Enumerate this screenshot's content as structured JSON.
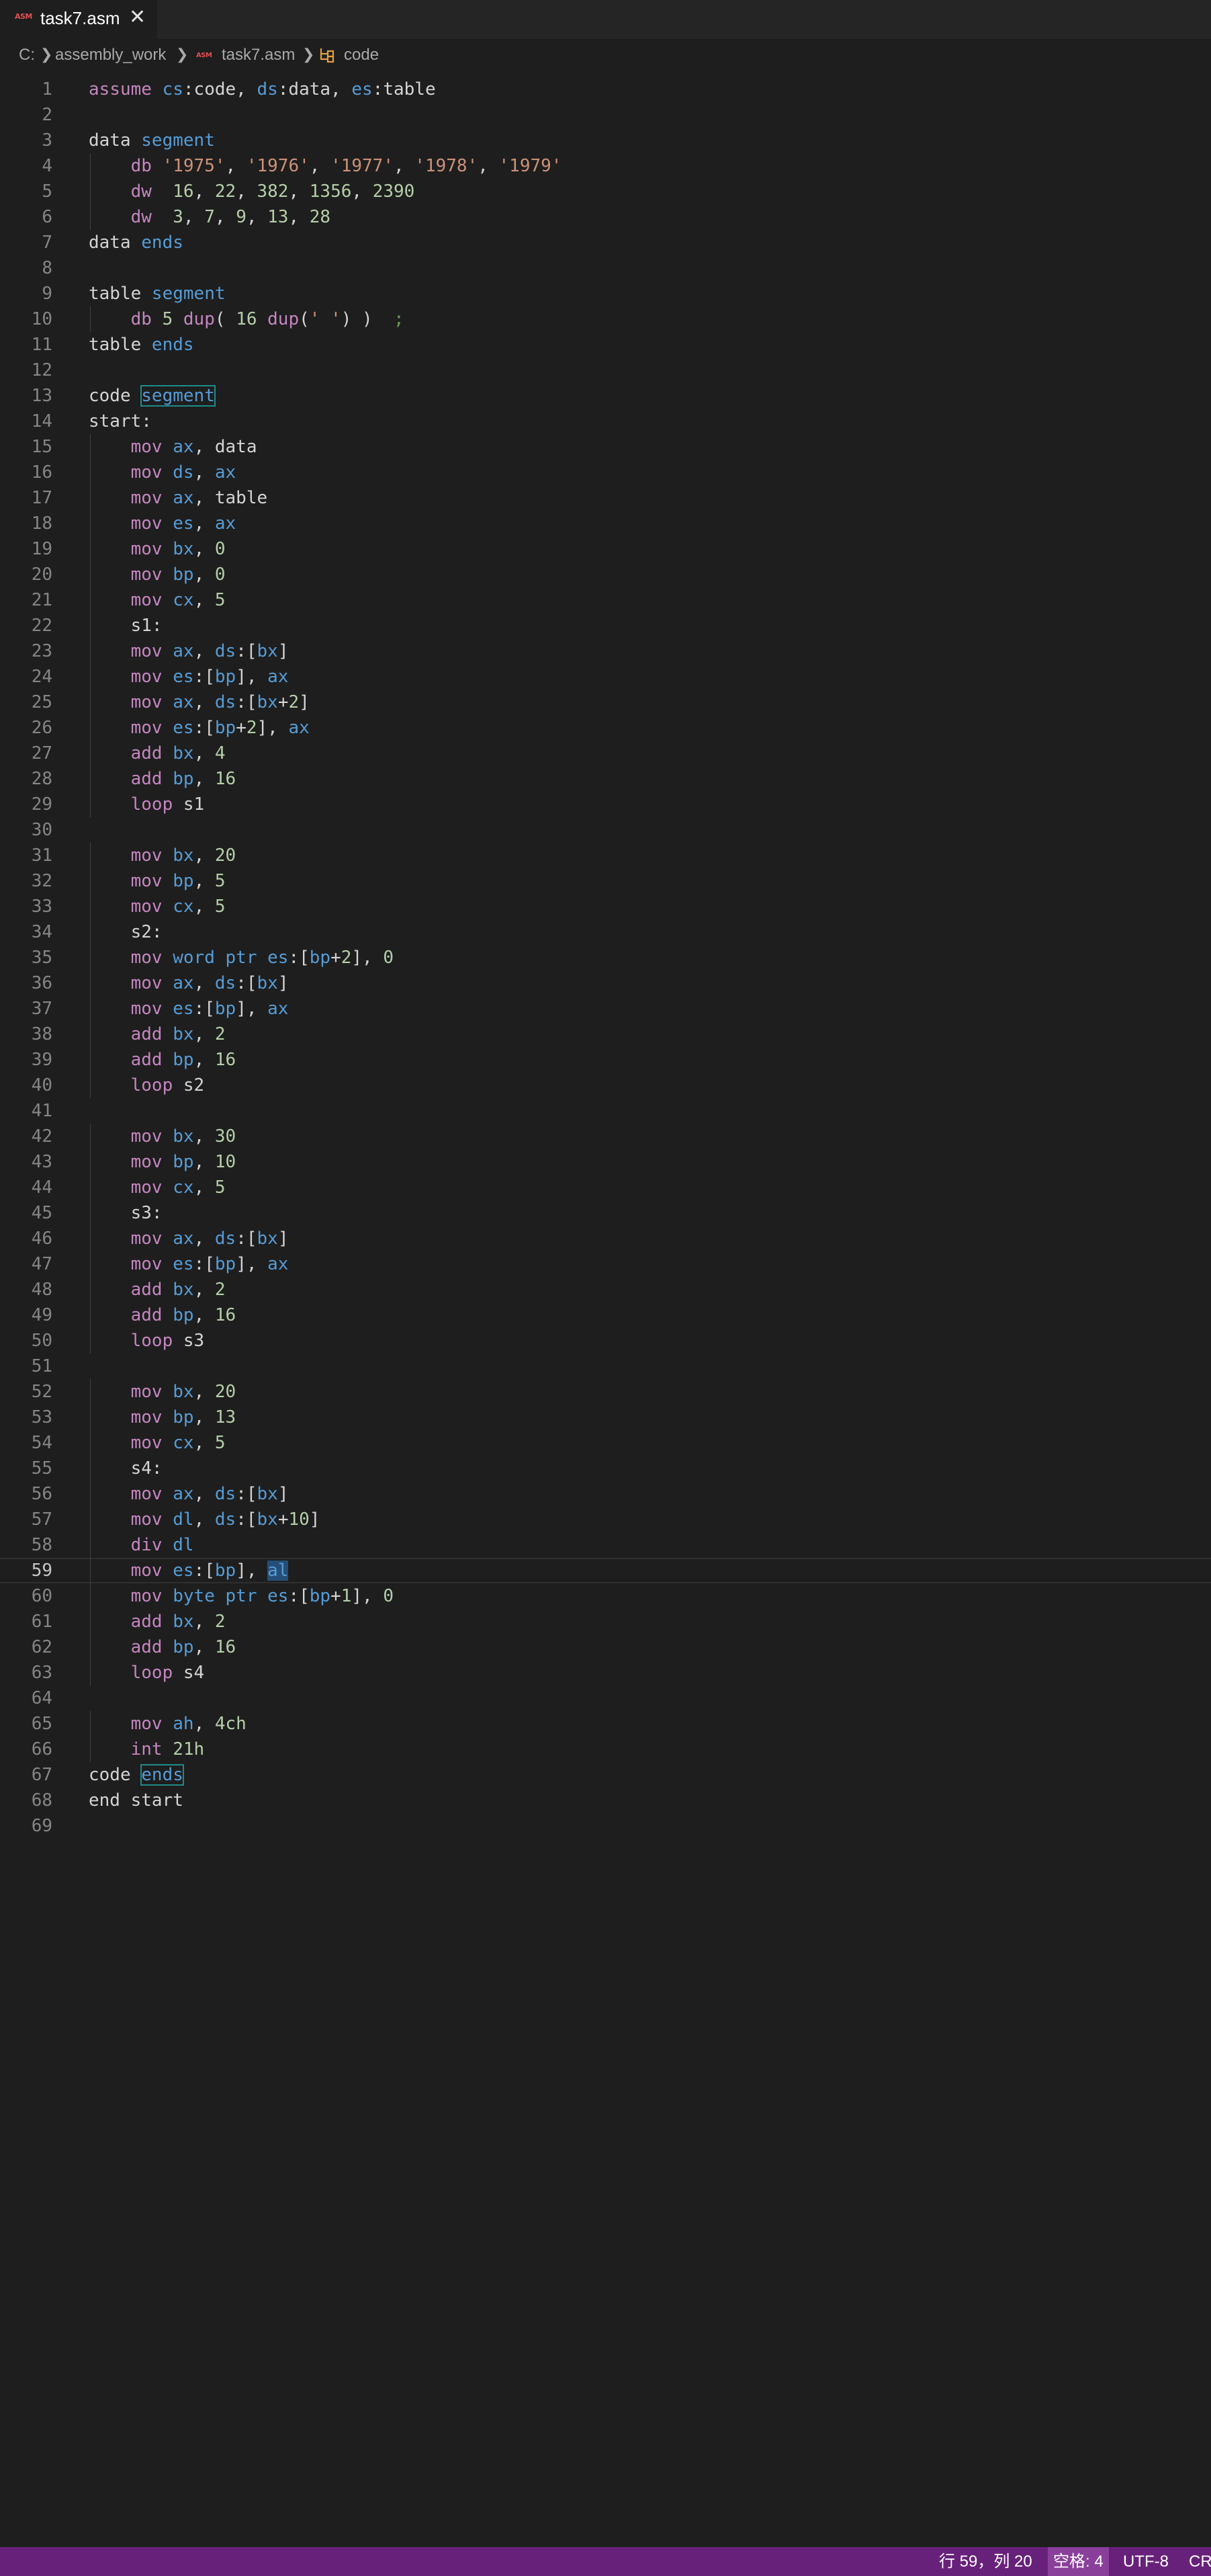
{
  "tab": {
    "title": "task7.asm",
    "icon": "ASM",
    "close": "✕"
  },
  "breadcrumb": {
    "drive": "C:",
    "folder": "assembly_work",
    "file_icon": "ASM",
    "file": "task7.asm",
    "symbol": "code"
  },
  "editor": {
    "current_line": 59,
    "lines": [
      "1",
      "2",
      "3",
      "4",
      "5",
      "6",
      "7",
      "8",
      "9",
      "10",
      "11",
      "12",
      "13",
      "14",
      "15",
      "16",
      "17",
      "18",
      "19",
      "20",
      "21",
      "22",
      "23",
      "24",
      "25",
      "26",
      "27",
      "28",
      "29",
      "30",
      "31",
      "32",
      "33",
      "34",
      "35",
      "36",
      "37",
      "38",
      "39",
      "40",
      "41",
      "42",
      "43",
      "44",
      "45",
      "46",
      "47",
      "48",
      "49",
      "50",
      "51",
      "52",
      "53",
      "54",
      "55",
      "56",
      "57",
      "58",
      "59",
      "60",
      "61",
      "62",
      "63",
      "64",
      "65",
      "66",
      "67",
      "68",
      "69"
    ],
    "code": [
      "assume cs:code, ds:data, es:table",
      "",
      "data segment",
      "    db '1975', '1976', '1977', '1978', '1979'",
      "    dw  16, 22, 382, 1356, 2390",
      "    dw  3, 7, 9, 13, 28",
      "data ends",
      "",
      "table segment",
      "    db 5 dup( 16 dup(' ') )  ;",
      "table ends",
      "",
      "code segment",
      "start:",
      "    mov ax, data",
      "    mov ds, ax",
      "    mov ax, table",
      "    mov es, ax",
      "    mov bx, 0",
      "    mov bp, 0",
      "    mov cx, 5",
      "    s1:",
      "    mov ax, ds:[bx]",
      "    mov es:[bp], ax",
      "    mov ax, ds:[bx+2]",
      "    mov es:[bp+2], ax",
      "    add bx, 4",
      "    add bp, 16",
      "    loop s1",
      "",
      "    mov bx, 20",
      "    mov bp, 5",
      "    mov cx, 5",
      "    s2:",
      "    mov word ptr es:[bp+2], 0",
      "    mov ax, ds:[bx]",
      "    mov es:[bp], ax",
      "    add bx, 2",
      "    add bp, 16",
      "    loop s2",
      "",
      "    mov bx, 30",
      "    mov bp, 10",
      "    mov cx, 5",
      "    s3:",
      "    mov ax, ds:[bx]",
      "    mov es:[bp], ax",
      "    add bx, 2",
      "    add bp, 16",
      "    loop s3",
      "",
      "    mov bx, 20",
      "    mov bp, 13",
      "    mov cx, 5",
      "    s4:",
      "    mov ax, ds:[bx]",
      "    mov dl, ds:[bx+10]",
      "    div dl",
      "    mov es:[bp], al",
      "    mov byte ptr es:[bp+1], 0",
      "    add bx, 2",
      "    add bp, 16",
      "    loop s4",
      "",
      "    mov ah, 4ch",
      "    int 21h",
      "code ends",
      "end start",
      ""
    ]
  },
  "statusbar": {
    "position": "行 59，列 20",
    "spaces": "空格: 4",
    "encoding": "UTF-8",
    "eol": "CRLF"
  },
  "colors": {
    "keyword": "#c586c0",
    "register": "#569cd6",
    "number": "#b5cea8",
    "string": "#ce9178",
    "statusbar": "#68217a"
  }
}
